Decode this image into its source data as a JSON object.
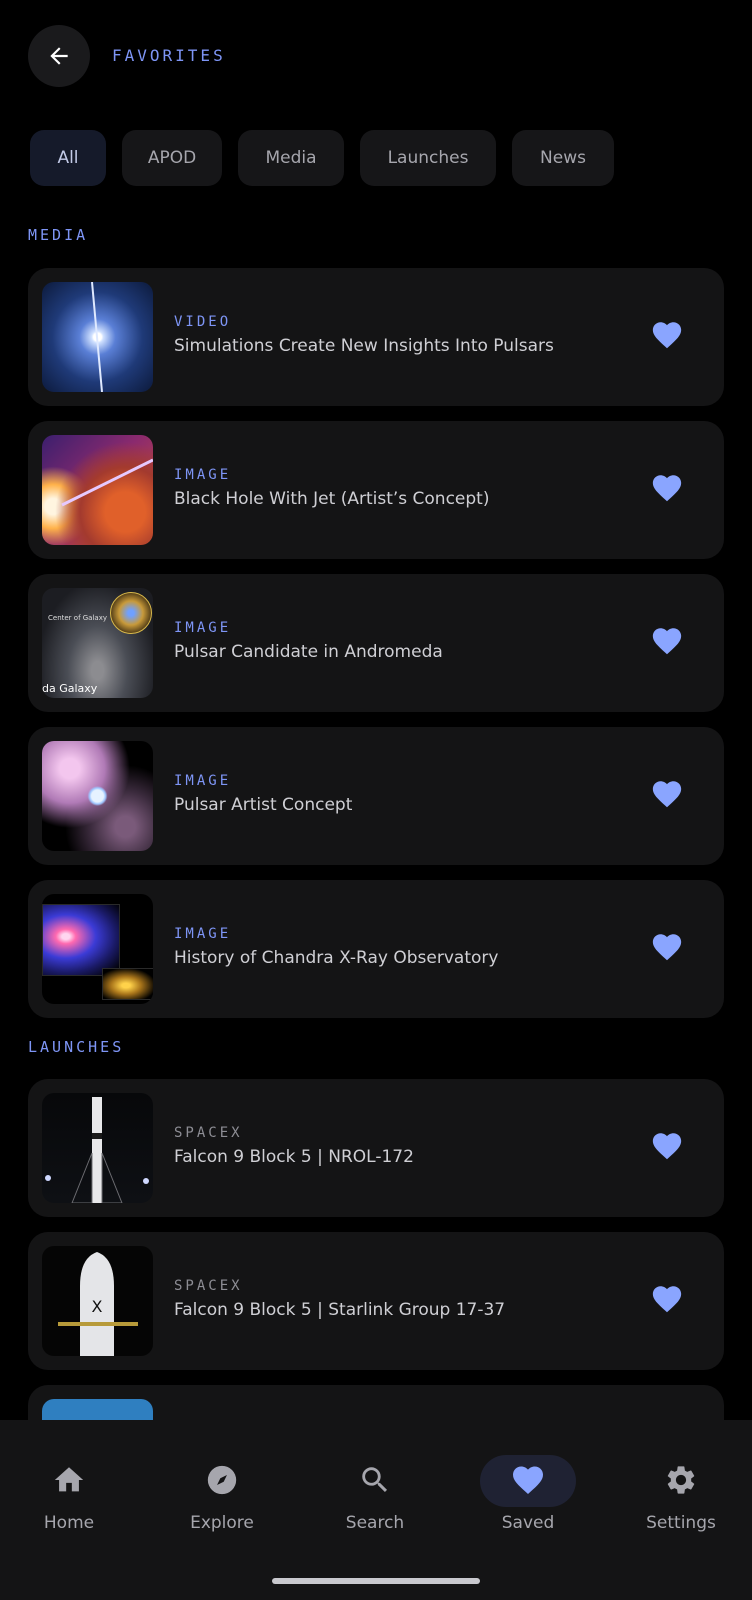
{
  "header": {
    "title": "FAVORITES"
  },
  "filters": [
    {
      "label": "All",
      "active": true
    },
    {
      "label": "APOD",
      "active": false
    },
    {
      "label": "Media",
      "active": false
    },
    {
      "label": "Launches",
      "active": false
    },
    {
      "label": "News",
      "active": false
    }
  ],
  "sections": {
    "media": {
      "label": "MEDIA",
      "items": [
        {
          "category": "VIDEO",
          "title": "Simulations Create New Insights Into Pulsars"
        },
        {
          "category": "IMAGE",
          "title": "Black Hole With Jet (Artist’s Concept)"
        },
        {
          "category": "IMAGE",
          "title": "Pulsar Candidate in Andromeda",
          "thumb_text": "da Galaxy",
          "thumb_text2": "Center of Galaxy"
        },
        {
          "category": "IMAGE",
          "title": "Pulsar Artist Concept"
        },
        {
          "category": "IMAGE",
          "title": "History of Chandra X-Ray Observatory"
        }
      ]
    },
    "launches": {
      "label": "LAUNCHES",
      "items": [
        {
          "category": "SPACEX",
          "title": "Falcon 9 Block 5 | NROL-172"
        },
        {
          "category": "SPACEX",
          "title": "Falcon 9 Block 5 | Starlink Group 17-37"
        }
      ]
    }
  },
  "nav": {
    "items": [
      {
        "label": "Home",
        "icon": "home-icon"
      },
      {
        "label": "Explore",
        "icon": "compass-icon"
      },
      {
        "label": "Search",
        "icon": "search-icon"
      },
      {
        "label": "Saved",
        "icon": "heart-icon",
        "active": true
      },
      {
        "label": "Settings",
        "icon": "gear-icon"
      }
    ]
  },
  "colors": {
    "accent": "#7e95f5",
    "heart": "#8aa5ff",
    "background": "#000000",
    "card": "#141415"
  }
}
